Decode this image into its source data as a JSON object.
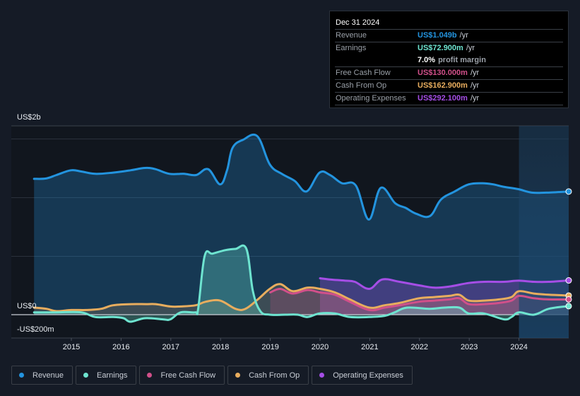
{
  "tooltip": {
    "date": "Dec 31 2024",
    "rows": [
      {
        "label": "Revenue",
        "value": "US$1.049b",
        "unit": "/yr",
        "color": "#2394df"
      },
      {
        "label": "Earnings",
        "value": "US$72.900m",
        "unit": "/yr",
        "color": "#6ee4d0"
      },
      {
        "label": "",
        "margin_pct": "7.0%",
        "margin_text": "profit margin"
      },
      {
        "label": "Free Cash Flow",
        "value": "US$130.000m",
        "unit": "/yr",
        "color": "#d1508a"
      },
      {
        "label": "Cash From Op",
        "value": "US$162.900m",
        "unit": "/yr",
        "color": "#e8ad5e"
      },
      {
        "label": "Operating Expenses",
        "value": "US$292.100m",
        "unit": "/yr",
        "color": "#a54ee6"
      }
    ]
  },
  "chart_data": {
    "type": "area",
    "title": "",
    "xlabel": "",
    "ylabel": "",
    "y_unit": "US$ billions",
    "ylim": [
      -0.2,
      1.6
    ],
    "y_tick_labels": [
      {
        "value": 1.6,
        "label": "US$2b"
      },
      {
        "value": 0,
        "label": "US$0"
      },
      {
        "value": -0.2,
        "label": "-US$200m"
      }
    ],
    "x_ticks": [
      2015,
      2016,
      2017,
      2018,
      2019,
      2020,
      2021,
      2022,
      2023,
      2024
    ],
    "xlim": [
      2014.25,
      2025.0
    ],
    "highlight_from": 2024.0,
    "grid": true,
    "legend_position": "bottom-left",
    "series": [
      {
        "name": "Revenue",
        "color": "#2394df",
        "x": [
          2014.25,
          2014.49,
          2014.7,
          2014.99,
          2015.2,
          2015.48,
          2015.84,
          2016.19,
          2016.48,
          2016.69,
          2016.97,
          2017.26,
          2017.51,
          2017.75,
          2017.99,
          2018.13,
          2018.24,
          2018.45,
          2018.74,
          2018.99,
          2019.23,
          2019.49,
          2019.73,
          2019.99,
          2020.2,
          2020.44,
          2020.72,
          2020.98,
          2021.22,
          2021.51,
          2021.72,
          2021.93,
          2022.21,
          2022.43,
          2022.71,
          2022.99,
          2023.27,
          2023.48,
          2023.69,
          2023.98,
          2024.26,
          2024.55,
          2025.0
        ],
        "values": [
          1.157,
          1.16,
          1.19,
          1.23,
          1.22,
          1.2,
          1.21,
          1.23,
          1.25,
          1.24,
          1.2,
          1.2,
          1.19,
          1.24,
          1.11,
          1.23,
          1.42,
          1.49,
          1.52,
          1.28,
          1.2,
          1.14,
          1.05,
          1.21,
          1.19,
          1.12,
          1.1,
          0.81,
          1.08,
          0.95,
          0.91,
          0.86,
          0.84,
          0.98,
          1.05,
          1.11,
          1.12,
          1.11,
          1.09,
          1.07,
          1.04,
          1.04,
          1.049
        ]
      },
      {
        "name": "Earnings",
        "color": "#6ee4d0",
        "x": [
          2014.25,
          2014.7,
          2015.2,
          2015.48,
          2015.84,
          2016.05,
          2016.19,
          2016.48,
          2016.84,
          2016.99,
          2017.2,
          2017.49,
          2017.55,
          2017.68,
          2017.84,
          2018.1,
          2018.3,
          2018.52,
          2018.65,
          2018.8,
          2018.99,
          2019.3,
          2019.55,
          2019.75,
          2019.99,
          2020.3,
          2020.6,
          2020.99,
          2021.3,
          2021.5,
          2021.75,
          2022.2,
          2022.5,
          2022.8,
          2022.99,
          2023.3,
          2023.7,
          2023.85,
          2024.0,
          2024.3,
          2024.6,
          2025.0
        ],
        "values": [
          0.02,
          0.02,
          0.02,
          -0.02,
          -0.02,
          -0.03,
          -0.06,
          -0.03,
          -0.04,
          -0.04,
          0.02,
          0.02,
          0.05,
          0.5,
          0.52,
          0.55,
          0.56,
          0.56,
          0.2,
          0.03,
          0.0,
          0.0,
          0.0,
          -0.02,
          0.01,
          0.01,
          -0.02,
          -0.02,
          -0.01,
          0.02,
          0.06,
          0.05,
          0.06,
          0.06,
          0.01,
          0.01,
          -0.04,
          -0.02,
          0.02,
          0.0,
          0.05,
          0.073
        ]
      },
      {
        "name": "Free Cash Flow",
        "color": "#d1508a",
        "x": [
          2019.0,
          2019.2,
          2019.45,
          2019.75,
          2020.0,
          2020.3,
          2020.6,
          2020.99,
          2021.3,
          2021.6,
          2021.99,
          2022.3,
          2022.6,
          2022.8,
          2022.99,
          2023.3,
          2023.6,
          2023.85,
          2024.0,
          2024.3,
          2024.6,
          2025.0
        ],
        "values": [
          0.19,
          0.22,
          0.18,
          0.21,
          0.19,
          0.17,
          0.11,
          0.04,
          0.06,
          0.08,
          0.11,
          0.12,
          0.13,
          0.14,
          0.09,
          0.09,
          0.1,
          0.12,
          0.16,
          0.14,
          0.13,
          0.13
        ]
      },
      {
        "name": "Cash From Op",
        "color": "#e8ad5e",
        "x": [
          2014.25,
          2014.5,
          2014.7,
          2015.0,
          2015.3,
          2015.6,
          2015.84,
          2016.2,
          2016.5,
          2016.7,
          2016.99,
          2017.2,
          2017.5,
          2017.7,
          2017.99,
          2018.3,
          2018.5,
          2018.75,
          2018.99,
          2019.2,
          2019.45,
          2019.75,
          2020.0,
          2020.3,
          2020.6,
          2020.99,
          2021.3,
          2021.6,
          2021.99,
          2022.3,
          2022.6,
          2022.8,
          2022.99,
          2023.3,
          2023.6,
          2023.85,
          2024.0,
          2024.3,
          2024.6,
          2025.0
        ],
        "values": [
          0.06,
          0.05,
          0.03,
          0.04,
          0.04,
          0.05,
          0.08,
          0.09,
          0.09,
          0.09,
          0.07,
          0.07,
          0.08,
          0.11,
          0.12,
          0.05,
          0.05,
          0.13,
          0.22,
          0.26,
          0.2,
          0.23,
          0.22,
          0.19,
          0.13,
          0.06,
          0.08,
          0.1,
          0.14,
          0.15,
          0.16,
          0.17,
          0.12,
          0.12,
          0.13,
          0.15,
          0.2,
          0.18,
          0.17,
          0.163
        ]
      },
      {
        "name": "Operating Expenses",
        "color": "#a54ee6",
        "x": [
          2020.0,
          2020.2,
          2020.5,
          2020.7,
          2020.99,
          2021.25,
          2021.6,
          2021.99,
          2022.3,
          2022.6,
          2022.99,
          2023.3,
          2023.7,
          2023.99,
          2024.3,
          2024.6,
          2025.0
        ],
        "values": [
          0.31,
          0.3,
          0.29,
          0.28,
          0.22,
          0.3,
          0.28,
          0.25,
          0.23,
          0.24,
          0.27,
          0.28,
          0.28,
          0.29,
          0.28,
          0.28,
          0.292
        ]
      }
    ]
  },
  "legend": [
    {
      "label": "Revenue",
      "color": "#2394df"
    },
    {
      "label": "Earnings",
      "color": "#6ee4d0"
    },
    {
      "label": "Free Cash Flow",
      "color": "#d1508a"
    },
    {
      "label": "Cash From Op",
      "color": "#e8ad5e"
    },
    {
      "label": "Operating Expenses",
      "color": "#a54ee6"
    }
  ]
}
